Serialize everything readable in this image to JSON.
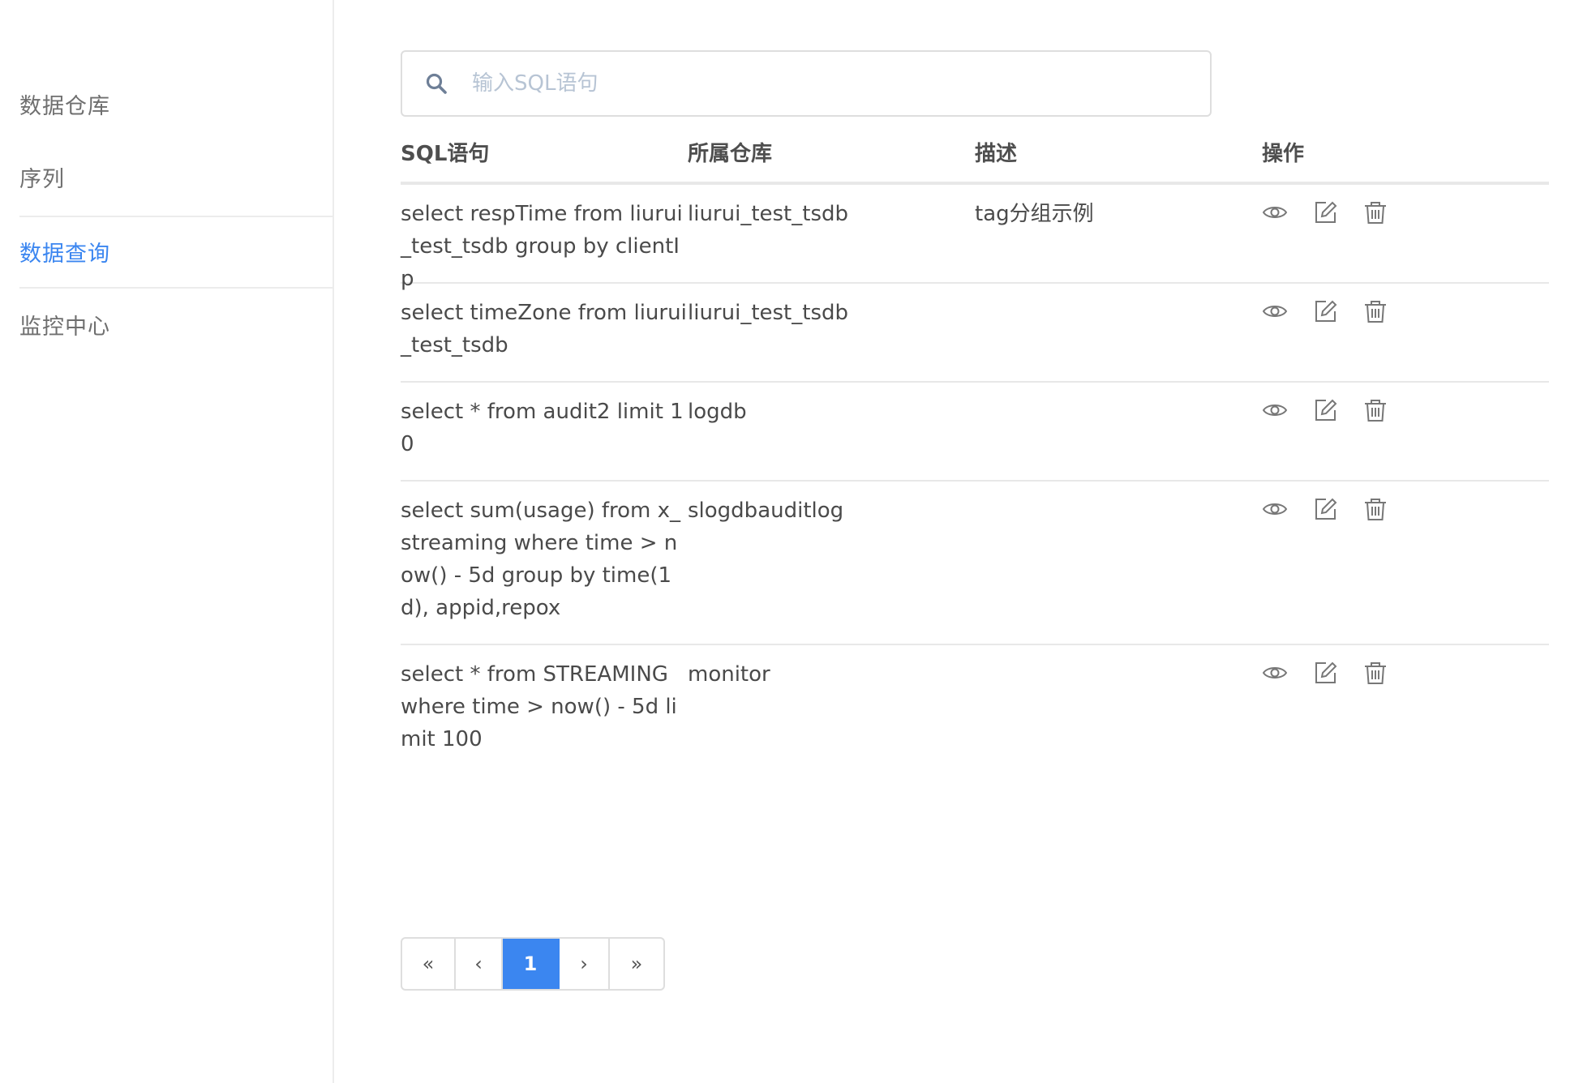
{
  "sidebar": {
    "items": [
      {
        "label": "数据仓库",
        "active": false
      },
      {
        "label": "序列",
        "active": false
      },
      {
        "label": "数据查询",
        "active": true
      },
      {
        "label": "监控中心",
        "active": false
      }
    ]
  },
  "search": {
    "placeholder": "输入SQL语句",
    "value": ""
  },
  "table": {
    "headers": {
      "sql": "SQL语句",
      "db": "所属仓库",
      "desc": "描述",
      "actions": "操作"
    },
    "rows": [
      {
        "sql": "select respTime from liurui_test_tsdb group by clientIp",
        "db": "liurui_test_tsdb",
        "desc": "tag分组示例"
      },
      {
        "sql": "select timeZone from liurui_test_tsdb",
        "db": "liurui_test_tsdb",
        "desc": ""
      },
      {
        "sql": "select * from audit2 limit 10",
        "db": "logdb",
        "desc": ""
      },
      {
        "sql": "select sum(usage) from x_streaming where time > now() - 5d group by time(1d), appid,repox",
        "db": "slogdbauditlog",
        "desc": ""
      },
      {
        "sql": "select * from STREAMING where time > now() - 5d limit 100",
        "db": "monitor",
        "desc": ""
      }
    ]
  },
  "pagination": {
    "first": "«",
    "prev": "‹",
    "current": "1",
    "next": "›",
    "last": "»"
  },
  "icons": {
    "view": "eye-icon",
    "edit": "edit-icon",
    "delete": "trash-icon",
    "search": "search-icon"
  },
  "colors": {
    "accent": "#3b86f0",
    "placeholder": "#b7c4d4",
    "border": "#e8e8e8"
  }
}
